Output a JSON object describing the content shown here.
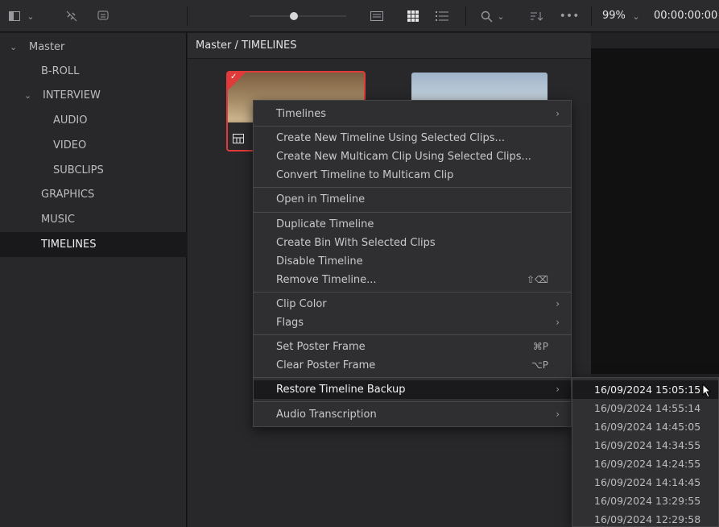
{
  "toolbar": {
    "zoom_level": "99%",
    "timecode": "00:00:00:00",
    "icons": [
      "sidebar-toggle-icon",
      "chevron-down-icon",
      "link-off-icon",
      "metadata-icon",
      "zoom-slider",
      "thumbnail-view-icon",
      "grid-view-icon",
      "list-view-icon",
      "search-icon",
      "sort-icon",
      "more-icon"
    ]
  },
  "sidebar": {
    "items": [
      {
        "label": "Master",
        "expanded": true
      },
      {
        "label": "B-ROLL"
      },
      {
        "label": "INTERVIEW",
        "expanded": true
      },
      {
        "label": "AUDIO"
      },
      {
        "label": "VIDEO"
      },
      {
        "label": "SUBCLIPS"
      },
      {
        "label": "GRAPHICS"
      },
      {
        "label": "MUSIC"
      },
      {
        "label": "TIMELINES",
        "selected": true
      }
    ]
  },
  "main": {
    "breadcrumb": "Master / TIMELINES",
    "accent_color": "#e03a3a"
  },
  "context_menu": {
    "timelines": "Timelines",
    "create_new_timeline": "Create New Timeline Using Selected Clips...",
    "create_new_multicam": "Create New Multicam Clip Using Selected Clips...",
    "convert_to_multicam": "Convert Timeline to Multicam Clip",
    "open_in_timeline": "Open in Timeline",
    "duplicate_timeline": "Duplicate Timeline",
    "create_bin": "Create Bin With Selected Clips",
    "disable_timeline": "Disable Timeline",
    "remove_timeline": "Remove Timeline...",
    "remove_shortcut": "⇧⌫",
    "clip_color": "Clip Color",
    "flags": "Flags",
    "set_poster_frame": "Set Poster Frame",
    "set_poster_shortcut": "⌘P",
    "clear_poster_frame": "Clear Poster Frame",
    "clear_poster_shortcut": "⌥P",
    "restore_backup": "Restore Timeline Backup",
    "audio_transcription": "Audio Transcription"
  },
  "backup_submenu": {
    "items": [
      "16/09/2024 15:05:15",
      "16/09/2024 14:55:14",
      "16/09/2024 14:45:05",
      "16/09/2024 14:34:55",
      "16/09/2024 14:24:55",
      "16/09/2024 14:14:45",
      "16/09/2024 13:29:55",
      "16/09/2024 12:29:58"
    ]
  }
}
